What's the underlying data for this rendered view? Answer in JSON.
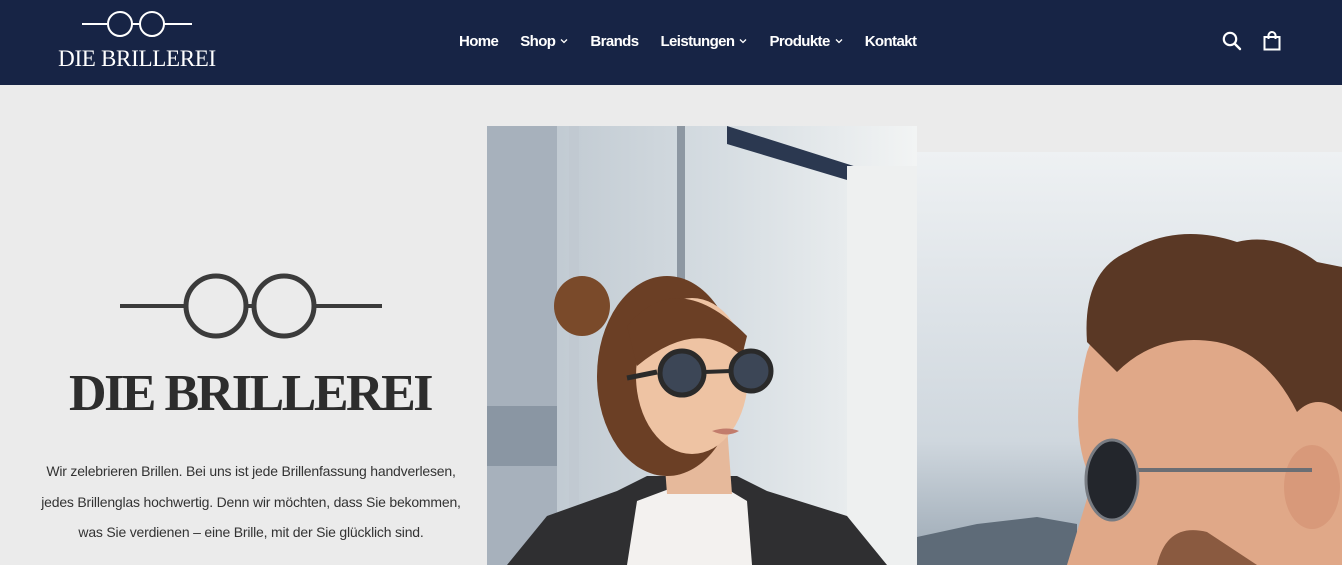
{
  "header": {
    "brand": "DIE BRILLEREI",
    "background_color": "#172445",
    "logo_icon": "glasses-icon",
    "nav": [
      {
        "label": "Home",
        "has_dropdown": false
      },
      {
        "label": "Shop",
        "has_dropdown": true
      },
      {
        "label": "Brands",
        "has_dropdown": false
      },
      {
        "label": "Leistungen",
        "has_dropdown": true
      },
      {
        "label": "Produkte",
        "has_dropdown": true
      },
      {
        "label": "Kontakt",
        "has_dropdown": false
      }
    ],
    "search_icon": "search-icon",
    "cart_icon": "shopping-bag-icon"
  },
  "hero": {
    "icon": "glasses-icon",
    "title": "DIE BRILLEREI",
    "text_lines": [
      "Wir zelebrieren Brillen. Bei uns ist jede Brillenfassung handverlesen,",
      "jedes Brillenglas hochwertig. Denn wir möchten, dass Sie bekommen,",
      "was Sie verdienen – eine Brille, mit der Sie glücklich sind."
    ],
    "background_color": "#ebebeb",
    "images": [
      {
        "name": "woman-with-round-sunglasses"
      },
      {
        "name": "man-with-aviator-sunglasses"
      }
    ]
  }
}
